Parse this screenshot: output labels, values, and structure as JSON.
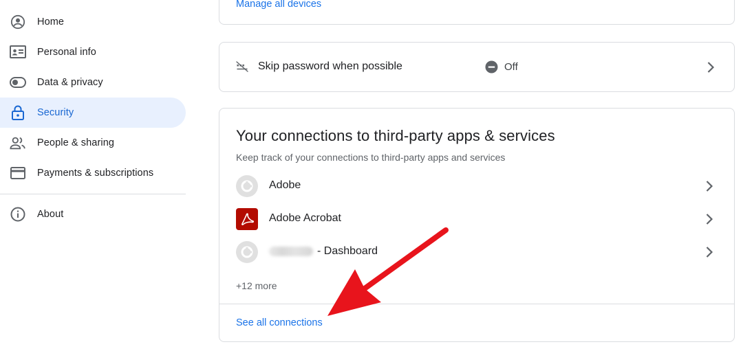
{
  "sidebar": {
    "items": [
      {
        "label": "Home",
        "icon": "account-circle-icon"
      },
      {
        "label": "Personal info",
        "icon": "id-card-icon"
      },
      {
        "label": "Data & privacy",
        "icon": "toggle-icon"
      },
      {
        "label": "Security",
        "icon": "lock-icon",
        "active": true
      },
      {
        "label": "People & sharing",
        "icon": "people-icon"
      },
      {
        "label": "Payments & subscriptions",
        "icon": "credit-card-icon"
      }
    ],
    "about": {
      "label": "About",
      "icon": "info-icon"
    }
  },
  "devices_card": {
    "link": "Manage all devices"
  },
  "skip_password": {
    "label": "Skip password when possible",
    "status": "Off"
  },
  "connections": {
    "title": "Your connections to third-party apps & services",
    "subtitle": "Keep track of your connections to third-party apps and services",
    "apps": [
      {
        "name": "Adobe",
        "icon": "generic-app-icon"
      },
      {
        "name": "Adobe Acrobat",
        "icon": "adobe-acrobat-icon"
      },
      {
        "name": "- Dashboard",
        "icon": "generic-app-icon"
      }
    ],
    "more": "+12 more",
    "see_all": "See all connections"
  },
  "colors": {
    "accent": "#1a73e8",
    "active_bg": "#e8f0fe",
    "acrobat_red": "#b30b00",
    "annotation_arrow": "#e8141c"
  }
}
